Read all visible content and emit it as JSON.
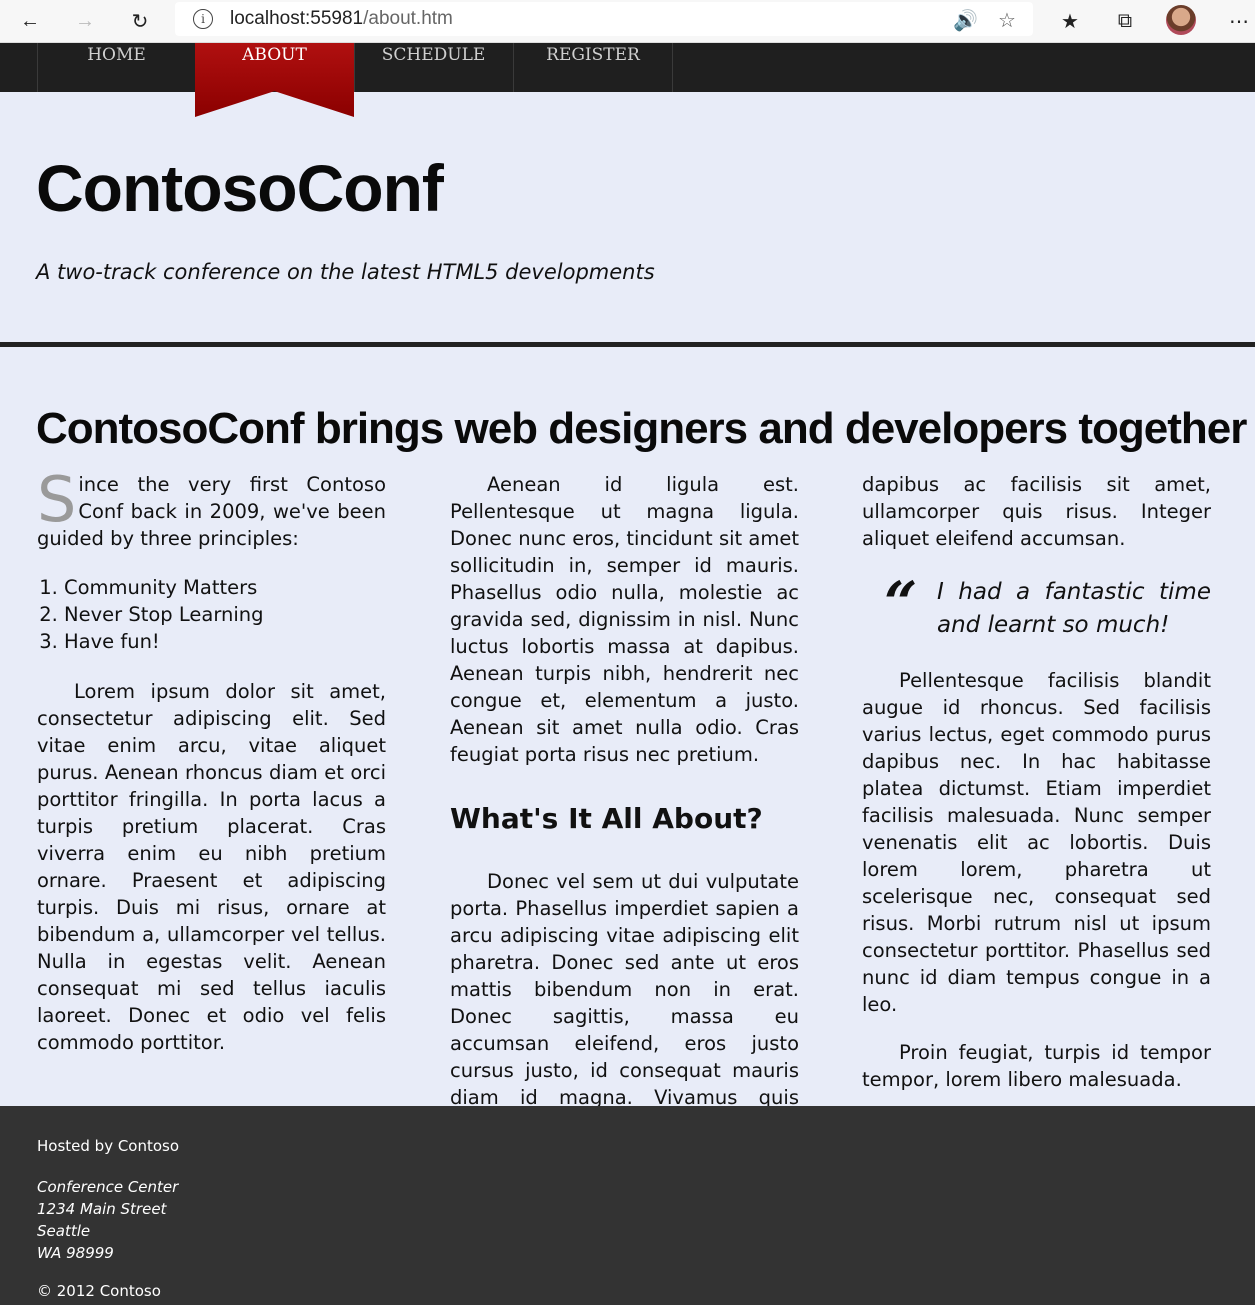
{
  "browser": {
    "url_host": "localhost:55981",
    "url_path": "/about.htm"
  },
  "nav": {
    "items": [
      {
        "label": "HOME"
      },
      {
        "label": "ABOUT",
        "active": true
      },
      {
        "label": "SCHEDULE"
      },
      {
        "label": "REGISTER"
      }
    ]
  },
  "header": {
    "title": "ContosoConf",
    "tagline": "A two-track conference on the latest HTML5 developments"
  },
  "article": {
    "headline": "ContosoConf brings web designers and developers together",
    "intro_dropcap": "S",
    "intro_text": "ince the very first Contoso Conf back in 2009, we've been guided by three principles:",
    "principles": [
      "Community Matters",
      "Never Stop Learning",
      "Have fun!"
    ],
    "para1": "Lorem ipsum dolor sit amet, consectetur adipiscing elit. Sed vitae enim arcu, vitae aliquet purus. Aenean rhoncus diam et orci porttitor fringilla. In porta lacus a turpis pretium placerat. Cras viverra enim eu nibh pretium ornare. Praesent et adipiscing turpis. Duis mi risus, ornare at bibendum a, ullamcorper vel tellus. Nulla in egestas velit. Aenean consequat mi sed tellus iaculis laoreet. Donec et odio vel felis commodo porttitor.",
    "para2": "Aenean id ligula est. Pellentesque ut magna ligula. Donec nunc eros, tincidunt sit amet sollicitudin in, semper id mauris. Phasellus odio nulla, molestie ac gravida sed, dignissim in nisl. Nunc luctus lobortis massa at dapibus. Aenean turpis nibh, hendrerit nec congue et, elementum a justo. Aenean sit amet nulla odio. Cras feugiat porta risus nec pretium.",
    "subheading": "What's It All About?",
    "para3": "Donec vel sem ut dui vulputate porta. Phasellus imperdiet sapien a arcu adipiscing vitae adipiscing elit pharetra. Donec sed ante ut eros mattis bibendum non in erat. Donec sagittis, massa eu accumsan eleifend, eros justo cursus justo, id consequat mauris diam id magna. Vivamus quis tortor massa. Nam ipsum metus,",
    "para3_cont": "dapibus ac facilisis sit amet, ullamcorper quis risus. Integer aliquet eleifend accumsan.",
    "quote": "I had a fantastic time and learnt so much!",
    "para4": "Pellentesque facilisis blandit augue id rhoncus. Sed facilisis varius lectus, eget commodo purus dapibus nec. In hac habitasse platea dictumst. Etiam imperdiet facilisis malesuada. Nunc semper venenatis elit ac lobortis. Duis lorem lorem, pharetra ut scelerisque nec, consequat sed risus. Morbi rutrum nisl ut ipsum consectetur porttitor. Phasellus sed nunc id diam tempus congue in a leo.",
    "para5": "Proin feugiat, turpis id tempor tempor, lorem libero malesuada."
  },
  "footer": {
    "hosted": "Hosted by Contoso",
    "address": [
      "Conference Center",
      "1234 Main Street",
      "Seattle",
      "WA 98999"
    ],
    "copyright": "© 2012 Contoso"
  }
}
